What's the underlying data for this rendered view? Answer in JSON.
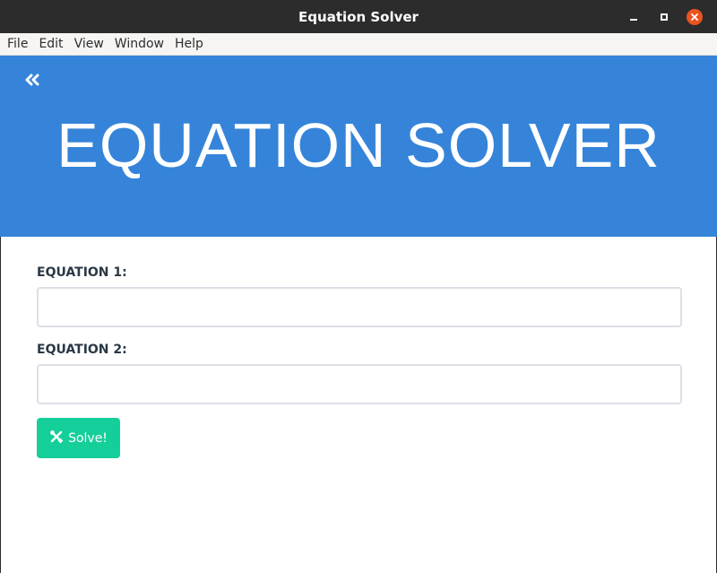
{
  "window": {
    "title": "Equation Solver",
    "controls": {
      "minimize": "minimize-icon",
      "maximize": "maximize-icon",
      "close": "close-icon"
    }
  },
  "menubar": {
    "items": [
      "File",
      "Edit",
      "View",
      "Window",
      "Help"
    ]
  },
  "hero": {
    "title": "EQUATION SOLVER",
    "back_icon": "double-chevron-left-icon"
  },
  "form": {
    "equation1": {
      "label": "EQUATION 1:",
      "value": ""
    },
    "equation2": {
      "label": "EQUATION 2:",
      "value": ""
    },
    "solve_button": {
      "label": "Solve!",
      "icon": "tools-icon"
    }
  },
  "colors": {
    "hero_bg": "#3584d9",
    "button_bg": "#15cf9a",
    "titlebar_bg": "#2c2c2c",
    "close_button": "#e95420",
    "label_text": "#2b3845"
  }
}
